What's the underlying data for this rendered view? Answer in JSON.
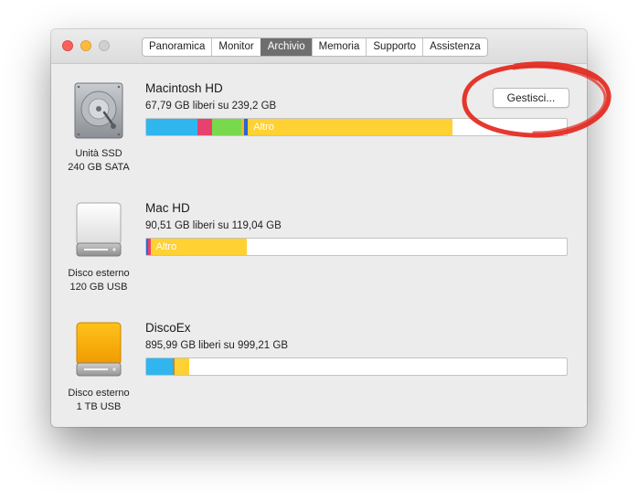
{
  "window": {
    "tabs": [
      {
        "label": "Panoramica",
        "active": false
      },
      {
        "label": "Monitor",
        "active": false
      },
      {
        "label": "Archivio",
        "active": true
      },
      {
        "label": "Memoria",
        "active": false
      },
      {
        "label": "Supporto",
        "active": false
      },
      {
        "label": "Assistenza",
        "active": false
      }
    ]
  },
  "disks": [
    {
      "name": "Macintosh HD",
      "free_text": "67,79 GB liberi su 239,2 GB",
      "caption_line1": "Unità SSD",
      "caption_line2": "240 GB SATA",
      "icon": "internal-drive-icon",
      "manage_button": "Gestisci...",
      "segments": [
        {
          "color": "#30b6ef",
          "share": 0.121
        },
        {
          "color": "#e8416d",
          "share": 0.035
        },
        {
          "color": "#79d94c",
          "share": 0.07
        },
        {
          "color": "#f5b324",
          "share": 0.006
        },
        {
          "color": "#2766d4",
          "share": 0.01
        },
        {
          "color": "#ffd132",
          "share": 0.486,
          "label": "Altro"
        }
      ]
    },
    {
      "name": "Mac HD",
      "free_text": "90,51 GB liberi su 119,04 GB",
      "caption_line1": "Disco esterno",
      "caption_line2": "120 GB USB",
      "icon": "external-drive-icon",
      "segments": [
        {
          "color": "#2a6ad8",
          "share": 0.004
        },
        {
          "color": "#e8416d",
          "share": 0.006
        },
        {
          "color": "#ffd132",
          "share": 0.229,
          "label": "Altro"
        }
      ]
    },
    {
      "name": "DiscoEx",
      "free_text": "895,99 GB liberi su 999,21 GB",
      "caption_line1": "Disco esterno",
      "caption_line2": "1 TB USB",
      "icon": "orange-external-drive-icon",
      "segments": [
        {
          "color": "#30b6ef",
          "share": 0.062
        },
        {
          "color": "#b5893c",
          "share": 0.006
        },
        {
          "color": "#ffd132",
          "share": 0.035
        }
      ]
    }
  ],
  "colors": {
    "annotation_circle": "#e2231a",
    "active_tab": "#6e6e6e"
  }
}
